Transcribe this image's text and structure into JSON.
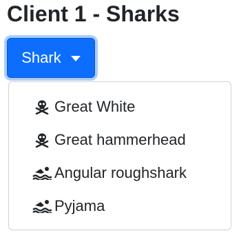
{
  "header": {
    "title": "Client 1 - Sharks"
  },
  "dropdown": {
    "toggle_label": "Shark",
    "items": [
      {
        "label": "Great White",
        "icon": "skull-crossbones-icon"
      },
      {
        "label": "Great hammerhead",
        "icon": "skull-crossbones-icon"
      },
      {
        "label": "Angular roughshark",
        "icon": "swimmer-icon"
      },
      {
        "label": "Pyjama",
        "icon": "swimmer-icon"
      }
    ]
  },
  "colors": {
    "primary": "#0d6efd",
    "text": "#212529"
  }
}
